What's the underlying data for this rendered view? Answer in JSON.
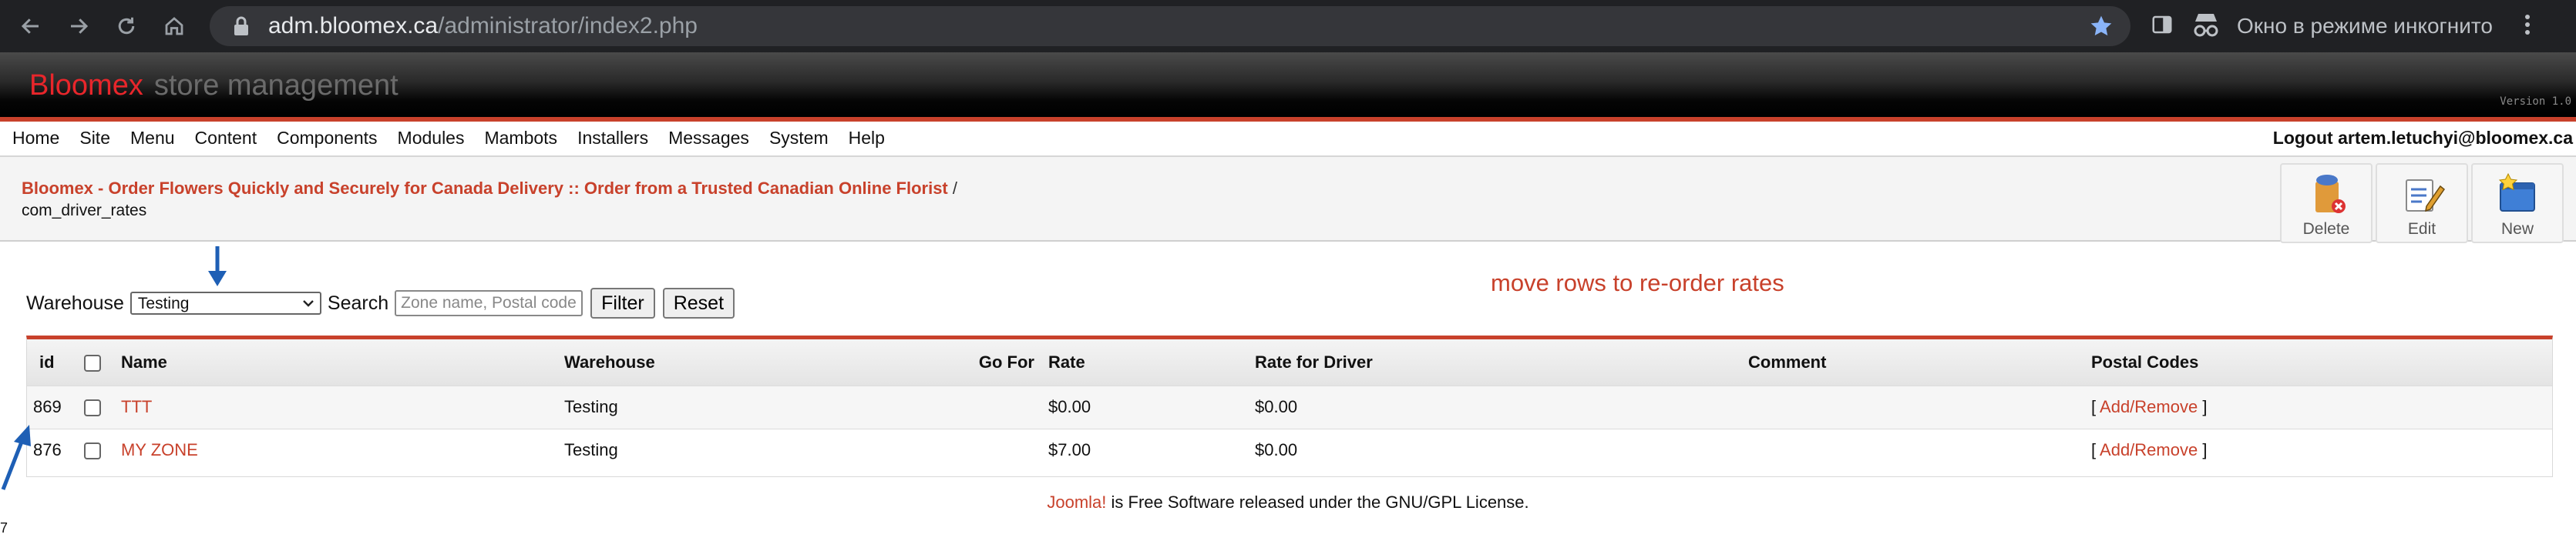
{
  "browser": {
    "url_host": "adm.bloomex.ca",
    "url_path": "/administrator/index2.php",
    "incognito_label": "Окно в режиме инкогнито"
  },
  "header": {
    "brand": "Bloomex",
    "subtitle": "store management",
    "version": "Version 1.0"
  },
  "menu": {
    "items": [
      "Home",
      "Site",
      "Menu",
      "Content",
      "Components",
      "Modules",
      "Mambots",
      "Installers",
      "Messages",
      "System",
      "Help"
    ],
    "logout": "Logout artem.letuchyi@bloomex.ca"
  },
  "pathway": {
    "site_title": "Bloomex - Order Flowers Quickly and Securely for Canada Delivery :: Order from a Trusted Canadian Online Florist",
    "separator": "/",
    "component": "com_driver_rates"
  },
  "toolbar": {
    "delete_label": "Delete",
    "edit_label": "Edit",
    "new_label": "New"
  },
  "filter": {
    "warehouse_label": "Warehouse",
    "warehouse_value": "Testing",
    "search_label": "Search",
    "search_placeholder": "Zone name, Postal code",
    "filter_button": "Filter",
    "reset_button": "Reset",
    "reorder_message": "move rows to re-order rates"
  },
  "table": {
    "headers": {
      "id": "id",
      "name": "Name",
      "warehouse": "Warehouse",
      "go_for": "Go For",
      "rate": "Rate",
      "rate_driver": "Rate for Driver",
      "comment": "Comment",
      "postal_codes": "Postal Codes"
    },
    "rows": [
      {
        "id": "869",
        "name": "TTT",
        "warehouse": "Testing",
        "go_for": "",
        "rate": "$0.00",
        "rate_driver": "$0.00",
        "comment": "",
        "postal_open": "[",
        "postal_link": "Add/Remove",
        "postal_close": "]"
      },
      {
        "id": "876",
        "name": "MY ZONE",
        "warehouse": "Testing",
        "go_for": "",
        "rate": "$7.00",
        "rate_driver": "$0.00",
        "comment": "",
        "postal_open": "[",
        "postal_link": "Add/Remove",
        "postal_close": "]"
      }
    ]
  },
  "footer": {
    "joomla_link": "Joomla!",
    "text": "is Free Software released under the GNU/GPL License."
  },
  "edge_number": "7",
  "colors": {
    "accent_red": "#c8412b",
    "brand_red": "#e8262b",
    "chrome_bg": "#202124",
    "annotation_arrow": "#1e5fb5"
  }
}
